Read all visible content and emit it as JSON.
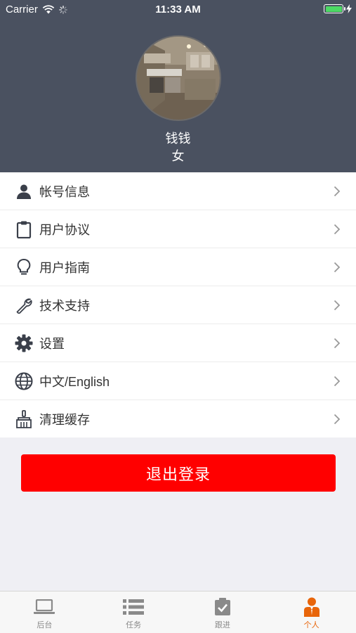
{
  "status_bar": {
    "carrier": "Carrier",
    "time": "11:33 AM",
    "battery_level": 1.0
  },
  "profile": {
    "name": "钱钱",
    "gender": "女",
    "avatar_icon": "kitchen-photo"
  },
  "menu": {
    "items": [
      {
        "label": "帐号信息",
        "icon": "user-icon"
      },
      {
        "label": "用户协议",
        "icon": "clipboard-icon"
      },
      {
        "label": "用户指南",
        "icon": "lightbulb-icon"
      },
      {
        "label": "技术支持",
        "icon": "wrench-icon"
      },
      {
        "label": "设置",
        "icon": "gear-icon"
      },
      {
        "label": "中文/English",
        "icon": "globe-icon"
      },
      {
        "label": "清理缓存",
        "icon": "broom-icon"
      }
    ]
  },
  "logout": {
    "label": "退出登录"
  },
  "tab_bar": {
    "tabs": [
      {
        "label": "后台",
        "icon": "laptop-icon",
        "active": false
      },
      {
        "label": "任务",
        "icon": "list-icon",
        "active": false
      },
      {
        "label": "跟进",
        "icon": "check-clipboard-icon",
        "active": false
      },
      {
        "label": "个人",
        "icon": "person-icon",
        "active": true
      }
    ]
  },
  "colors": {
    "header_bg": "#4a5160",
    "logout_bg": "#ff0000",
    "active_tab": "#e8650a",
    "inactive_tab": "#8a8a8a"
  }
}
